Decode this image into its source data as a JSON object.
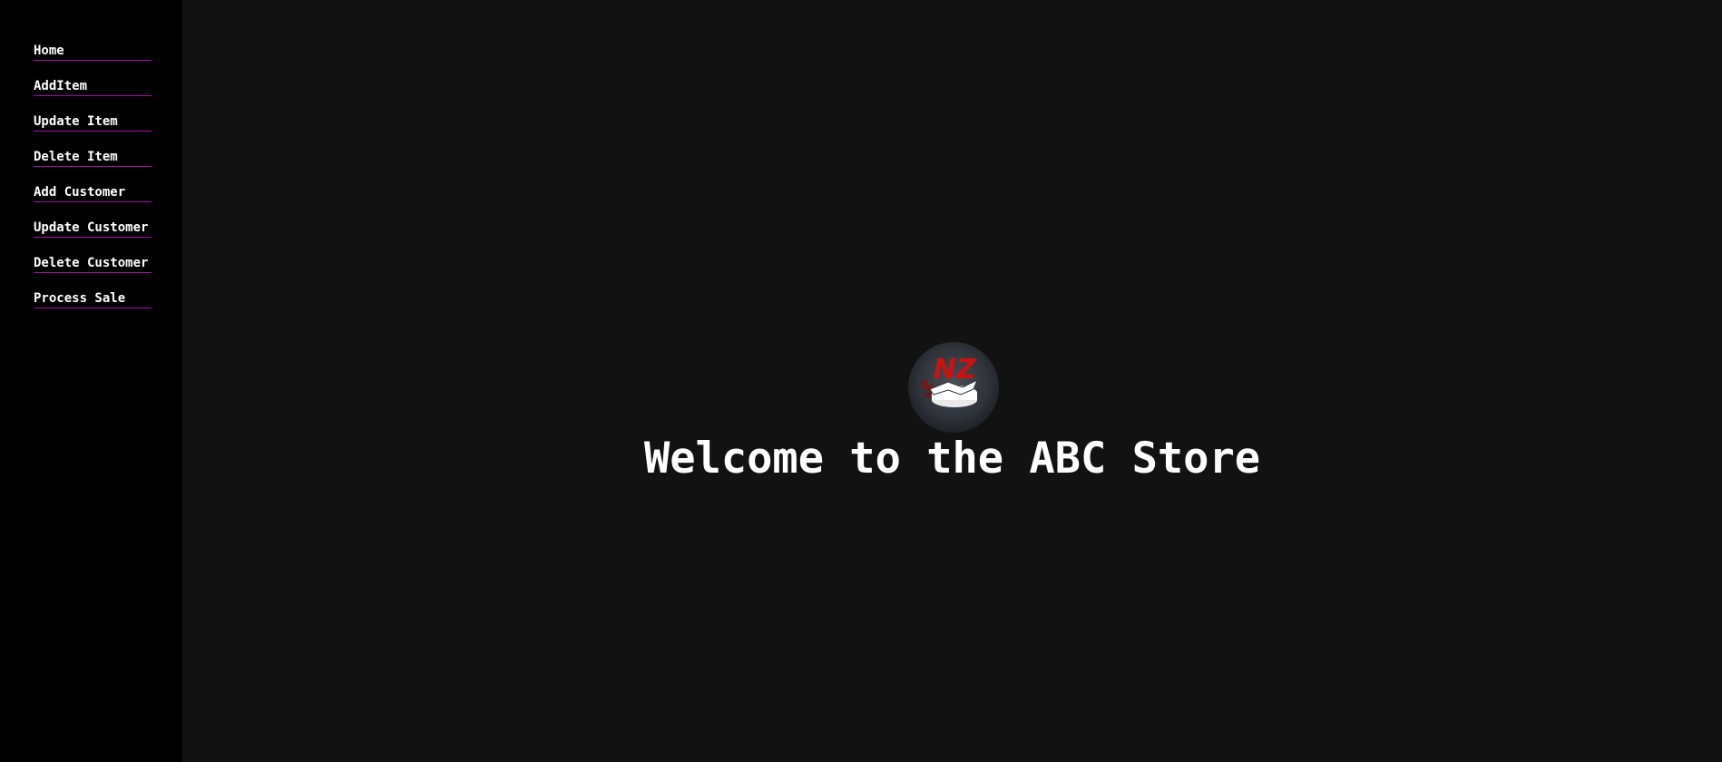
{
  "sidebar": {
    "items": [
      {
        "label": "Home"
      },
      {
        "label": "AddItem"
      },
      {
        "label": "Update Item"
      },
      {
        "label": "Delete Item"
      },
      {
        "label": "Add Customer"
      },
      {
        "label": "Update Customer"
      },
      {
        "label": "Delete Customer"
      },
      {
        "label": "Process Sale"
      }
    ]
  },
  "main": {
    "logo": {
      "text": "NZ",
      "icon": "store-logo-icon"
    },
    "welcome_text": "Welcome to the ABC Store"
  },
  "colors": {
    "sidebar_bg": "#000000",
    "main_bg": "#121212",
    "nav_underline": "#a40fa4",
    "logo_accent": "#cc1111",
    "text": "#ffffff"
  }
}
